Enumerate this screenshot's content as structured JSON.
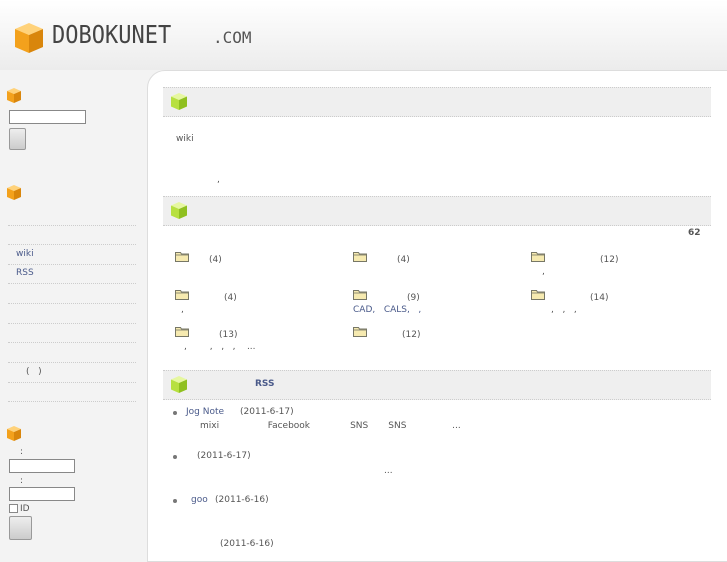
{
  "header": {
    "logo_text": "DOBOKUNET",
    "logo_suffix": ".COM"
  },
  "sidebar": {
    "links": [
      "wiki",
      "RSS"
    ],
    "paren_text": "(   )",
    "login": {
      "colon1": ":",
      "colon2": ":",
      "checkbox_label": "ID"
    }
  },
  "main": {
    "intro": {
      "wiki": "wiki",
      "dot": ","
    },
    "categories": {
      "total": "62",
      "items": [
        {
          "count": "(4)",
          "sub": ""
        },
        {
          "count": "(4)",
          "sub": ""
        },
        {
          "count": "(12)",
          "sub": ","
        },
        {
          "count": "(4)",
          "sub": ","
        },
        {
          "count": "(9)",
          "sub": "CAD,   CALS,   ,"
        },
        {
          "count": "(14)",
          "sub": ",   ,   ,"
        },
        {
          "count": "(13)",
          "sub": ",        ,   ,   ,    ..."
        },
        {
          "count": "(12)",
          "sub": ""
        }
      ]
    },
    "rss": {
      "title": "RSS",
      "entries": [
        {
          "link": "Jog Note",
          "date": "(2011-6-17)",
          "desc": "mixi                 Facebook              SNS       SNS                ..."
        },
        {
          "link": "",
          "date": "(2011-6-17)",
          "desc": "..."
        },
        {
          "link": "goo",
          "date": "(2011-6-16)",
          "desc": ""
        },
        {
          "link": "",
          "date": "(2011-6-16)",
          "desc": ""
        }
      ]
    }
  },
  "colors": {
    "cube_orange": "#f0a020",
    "cube_green": "#a8d830",
    "link": "#4a5a8a"
  }
}
